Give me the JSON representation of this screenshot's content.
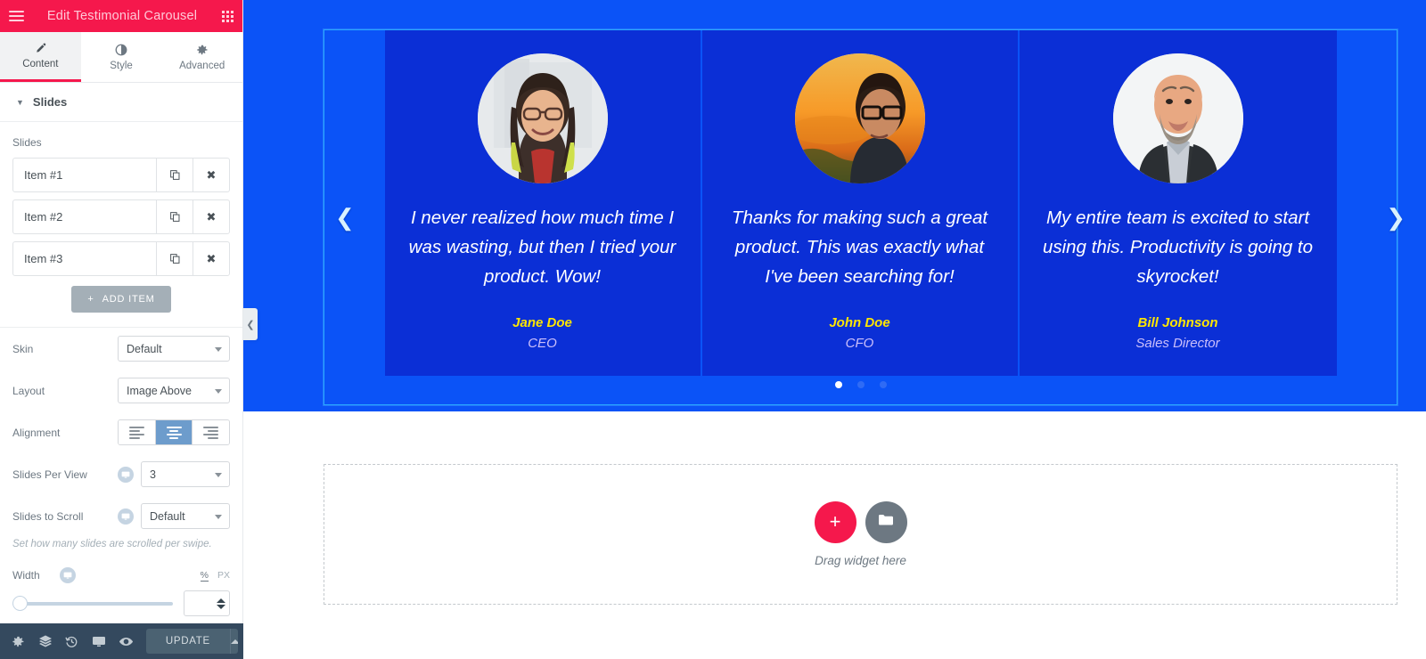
{
  "panel": {
    "header": {
      "title": "Edit Testimonial Carousel",
      "menu_icon": "hamburger-menu-icon",
      "apps_icon": "widgets-grid-icon"
    },
    "tabs": [
      {
        "label": "Content",
        "icon": "pencil-icon",
        "active": true
      },
      {
        "label": "Style",
        "icon": "contrast-circle-icon",
        "active": false
      },
      {
        "label": "Advanced",
        "icon": "gear-icon",
        "active": false
      }
    ],
    "section": {
      "title": "Slides",
      "collapsed": false,
      "caret": "chevron-down-icon"
    },
    "repeater": {
      "label": "Slides",
      "items": [
        {
          "title": "Item #1",
          "duplicate_icon": "copy-icon",
          "remove_icon": "close-x-icon"
        },
        {
          "title": "Item #2",
          "duplicate_icon": "copy-icon",
          "remove_icon": "close-x-icon"
        },
        {
          "title": "Item #3",
          "duplicate_icon": "copy-icon",
          "remove_icon": "close-x-icon"
        }
      ],
      "add_button": "ADD ITEM",
      "add_icon": "plus-icon"
    },
    "controls": {
      "skin": {
        "label": "Skin",
        "value": "Default"
      },
      "layout": {
        "label": "Layout",
        "value": "Image Above"
      },
      "alignment": {
        "label": "Alignment",
        "options": [
          "align-left",
          "align-center",
          "align-right"
        ],
        "selected": "align-center"
      },
      "slides_per_view": {
        "label": "Slides Per View",
        "value": "3",
        "device_icon": "desktop-icon"
      },
      "slides_to_scroll": {
        "label": "Slides to Scroll",
        "value": "Default",
        "device_icon": "desktop-icon"
      },
      "slides_to_scroll_desc": "Set how many slides are scrolled per swipe.",
      "width": {
        "label": "Width",
        "device_icon": "desktop-icon",
        "units": [
          "%",
          "PX"
        ],
        "selected_unit": "%",
        "slider_value": 0,
        "number_value": ""
      }
    },
    "footer": {
      "buttons": [
        {
          "icon": "gear-icon",
          "name": "settings"
        },
        {
          "icon": "layers-icon",
          "name": "navigator"
        },
        {
          "icon": "history-icon",
          "name": "history"
        },
        {
          "icon": "monitor-icon",
          "name": "responsive-mode"
        },
        {
          "icon": "eye-icon",
          "name": "preview"
        }
      ],
      "update_label": "UPDATE",
      "update_caret": "chevron-up-icon"
    },
    "collapse_handle_icon": "chevron-left-icon"
  },
  "canvas": {
    "carousel": {
      "prev_arrow": "chevron-left-icon",
      "next_arrow": "chevron-right-icon",
      "slides": [
        {
          "quote": "I never realized how much time I was wasting, but then I tried your product. Wow!",
          "name": "Jane Doe",
          "title": "CEO",
          "avatar": "avatar-woman-glasses"
        },
        {
          "quote": "Thanks for making such a great product. This was exactly what I've been searching for!",
          "name": "John Doe",
          "title": "CFO",
          "avatar": "avatar-man-glasses-sunset"
        },
        {
          "quote": "My entire team is excited to start using this. Productivity is going to skyrocket!",
          "name": "Bill Johnson",
          "title": "Sales Director",
          "avatar": "avatar-man-beard-suit"
        }
      ],
      "dots": [
        {
          "active": true
        },
        {
          "active": false
        },
        {
          "active": false
        }
      ]
    },
    "dropzone": {
      "label": "Drag widget here",
      "add_icon": "plus-icon",
      "folder_icon": "folder-icon"
    }
  },
  "colors": {
    "accent_pink": "#f5184c",
    "section_blue": "#0b53f7",
    "slide_blue": "#0b2fd6",
    "name_yellow": "#ffe600",
    "title_lavender": "#cbbffb",
    "selection_cyan": "#29a8ff",
    "footer_dark": "#34495e"
  }
}
